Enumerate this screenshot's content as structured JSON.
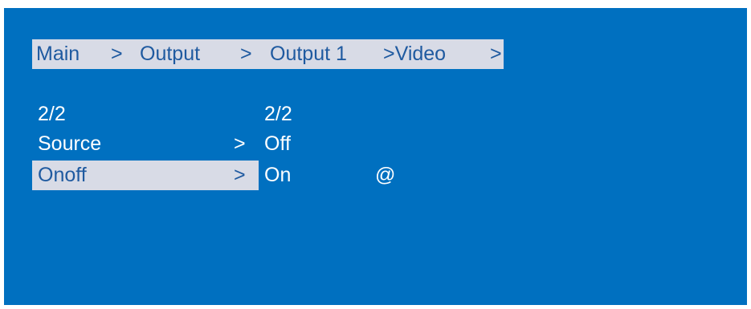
{
  "breadcrumb": {
    "main": "Main",
    "sep1": ">",
    "output": "Output",
    "sep2": ">",
    "output_1": "Output 1",
    "sep3": ">Video",
    "sep4": ">"
  },
  "page_indicator": {
    "left": "2/2",
    "right": "2/2"
  },
  "menu": {
    "items": [
      {
        "label": "Source",
        "arrow": ">",
        "value": "Off"
      },
      {
        "label": "Onoff",
        "arrow": ">",
        "value": "On",
        "marker": "@"
      }
    ],
    "selected_index": 1
  },
  "colors": {
    "background": "#0070c0",
    "highlight": "#d8dbe6",
    "highlight_text": "#1f5aa0",
    "text": "#ffffff"
  }
}
